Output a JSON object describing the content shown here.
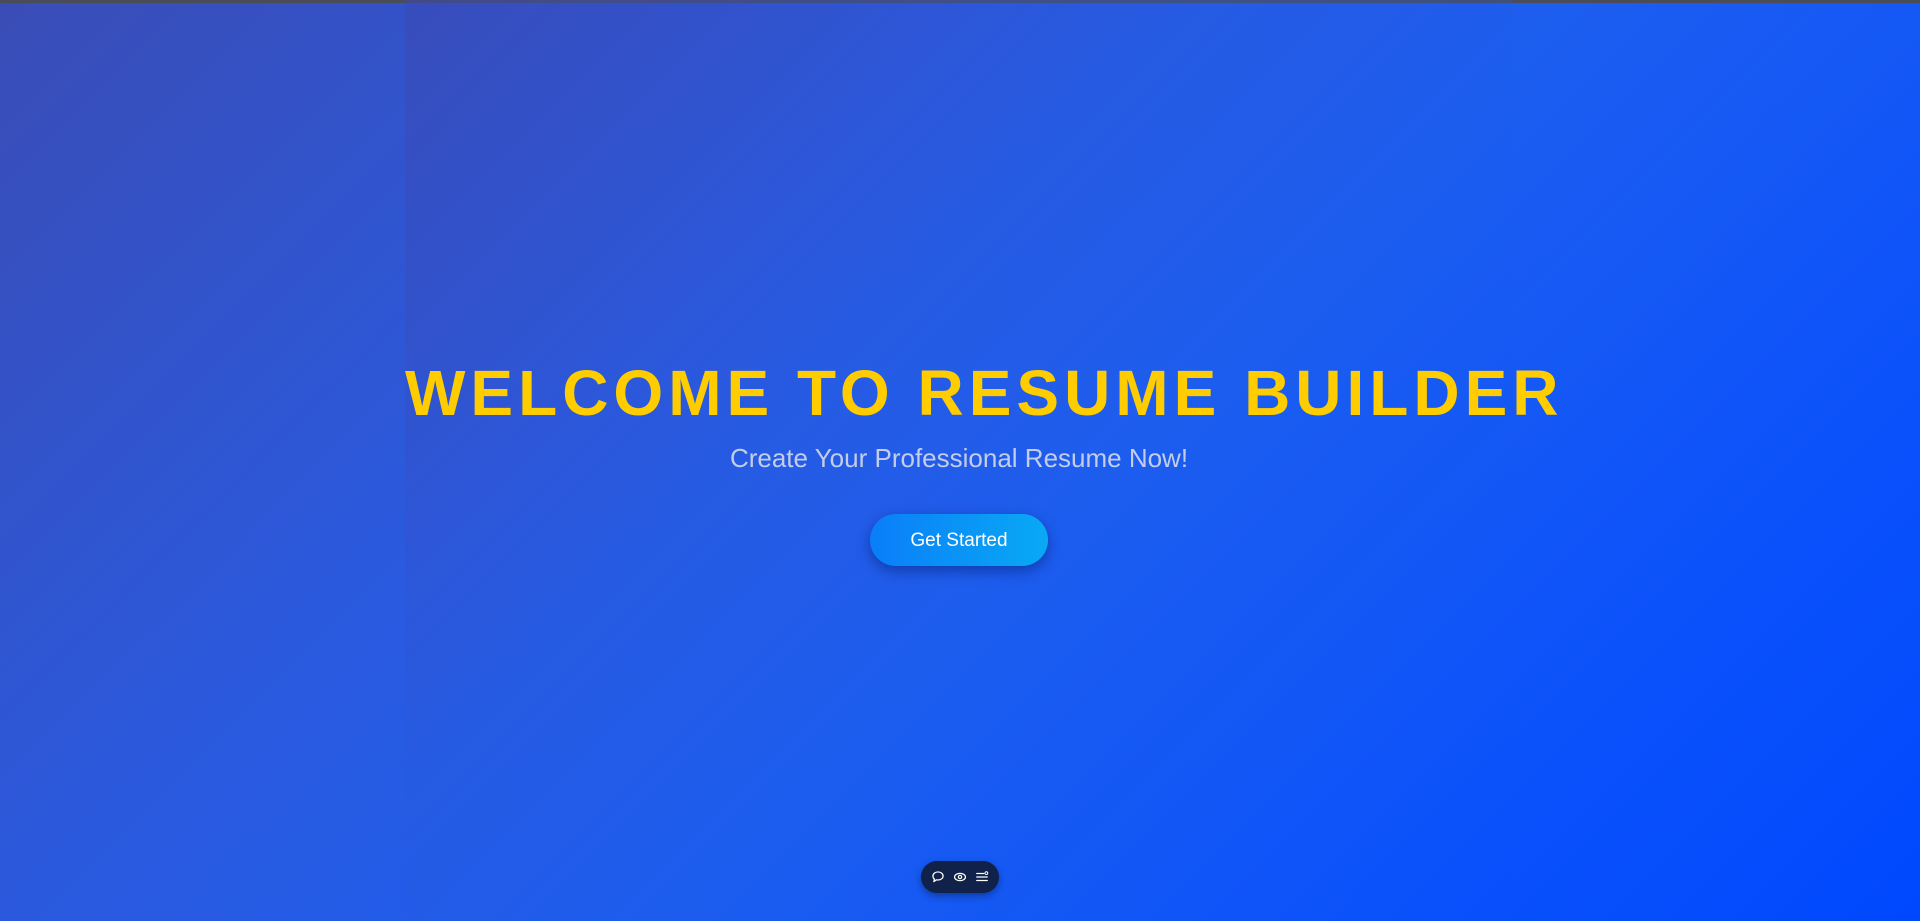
{
  "hero": {
    "title": "WELCOME TO RESUME BUILDER",
    "subtitle": "Create Your Professional Resume Now!",
    "cta_label": "Get Started"
  },
  "toolbar": {
    "buttons": [
      {
        "icon": "chat-bubble-icon"
      },
      {
        "icon": "eye-icon"
      },
      {
        "icon": "list-settings-icon"
      }
    ]
  },
  "colors": {
    "title": "#ffcc00",
    "subtitle": "#c3cdea",
    "cta_gradient_start": "#0a7ef8",
    "cta_gradient_end": "#09a9f5",
    "toolbar_bg": "#10214a"
  }
}
